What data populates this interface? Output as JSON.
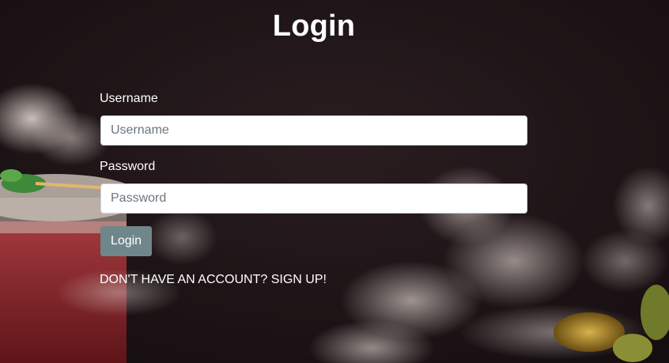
{
  "page": {
    "title": "Login"
  },
  "form": {
    "username": {
      "label": "Username",
      "placeholder": "Username",
      "value": ""
    },
    "password": {
      "label": "Password",
      "placeholder": "Password",
      "value": ""
    },
    "submit_label": "Login",
    "signup_link": "DON'T HAVE AN ACCOUNT? SIGN UP!"
  },
  "theme": {
    "background": "#1f1618",
    "button_color": "#6f878b",
    "text_color": "#ffffff"
  }
}
